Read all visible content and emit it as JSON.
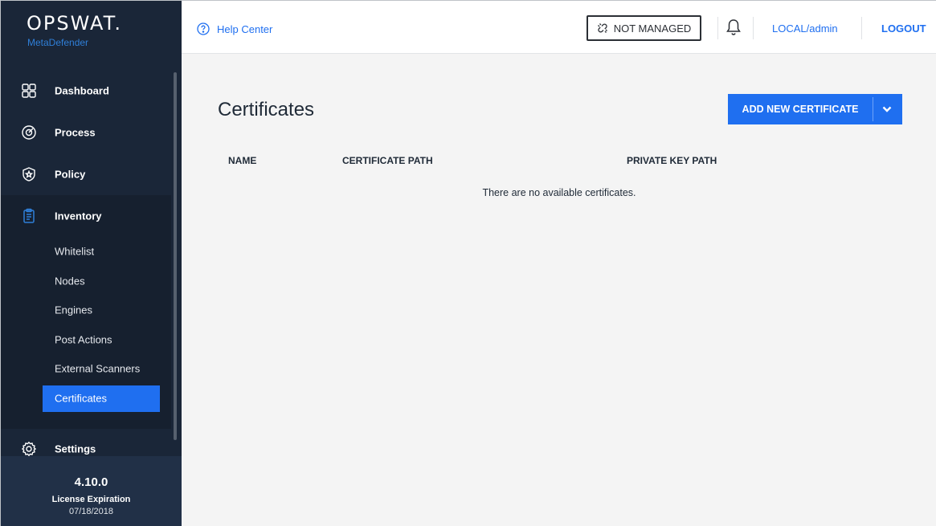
{
  "brand": {
    "logo": "OPSWAT.",
    "product": "MetaDefender"
  },
  "sidebar": {
    "items": [
      {
        "label": "Dashboard",
        "icon": "dashboard-grid-icon"
      },
      {
        "label": "Process",
        "icon": "target-icon"
      },
      {
        "label": "Policy",
        "icon": "shield-star-icon"
      },
      {
        "label": "Inventory",
        "icon": "clipboard-icon"
      }
    ],
    "inventory_sub": [
      "Whitelist",
      "Nodes",
      "Engines",
      "Post Actions",
      "External Scanners",
      "Certificates"
    ],
    "active_sub": "Certificates",
    "settings": {
      "label": "Settings",
      "icon": "gear-icon"
    },
    "footer": {
      "version": "4.10.0",
      "license_label": "License Expiration",
      "license_date": "07/18/2018"
    }
  },
  "topbar": {
    "help_label": "Help Center",
    "managed_label": "NOT MANAGED",
    "user_label": "LOCAL/admin",
    "logout_label": "LOGOUT"
  },
  "main": {
    "title": "Certificates",
    "add_button": "ADD NEW CERTIFICATE",
    "columns": [
      "NAME",
      "CERTIFICATE PATH",
      "PRIVATE KEY PATH"
    ],
    "empty_message": "There are no available certificates."
  },
  "colors": {
    "accent": "#1f6ff0",
    "sidebar_bg": "#1a2638",
    "footer_bg": "#213047"
  }
}
